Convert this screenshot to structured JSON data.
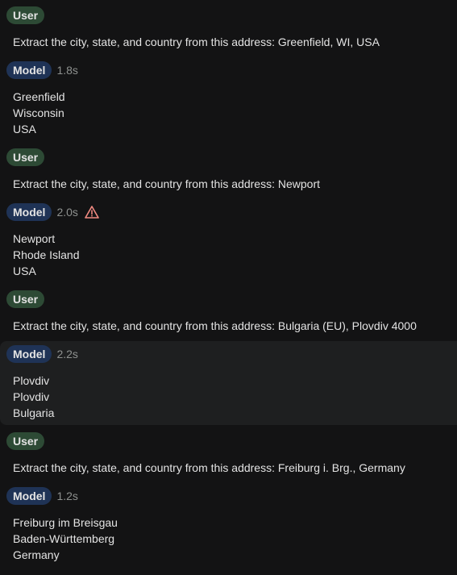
{
  "turns": [
    {
      "role": "User",
      "text": "Extract the city, state, and country from this address: Greenfield, WI, USA"
    },
    {
      "role": "Model",
      "time": "1.8s",
      "lines": [
        "Greenfield",
        "Wisconsin",
        "USA"
      ]
    },
    {
      "role": "User",
      "text": "Extract the city, state, and country from this address: Newport"
    },
    {
      "role": "Model",
      "time": "2.0s",
      "warning": "warning-icon",
      "lines": [
        "Newport",
        "Rhode Island",
        "USA"
      ]
    },
    {
      "role": "User",
      "text": "Extract the city, state, and country from this address: Bulgaria (EU), Plovdiv 4000"
    },
    {
      "role": "Model",
      "time": "2.2s",
      "lines": [
        "Plovdiv",
        "Plovdiv",
        "Bulgaria"
      ]
    },
    {
      "role": "User",
      "text": "Extract the city, state, and country from this address: Freiburg i. Brg., Germany"
    },
    {
      "role": "Model",
      "time": "1.2s",
      "lines": [
        "Freiburg im Breisgau",
        "Baden-Württemberg",
        "Germany"
      ]
    }
  ],
  "colors": {
    "background": "#131314",
    "user_chip": "#2d4a35",
    "model_chip": "#1f3356",
    "warning": "#f28b82"
  }
}
